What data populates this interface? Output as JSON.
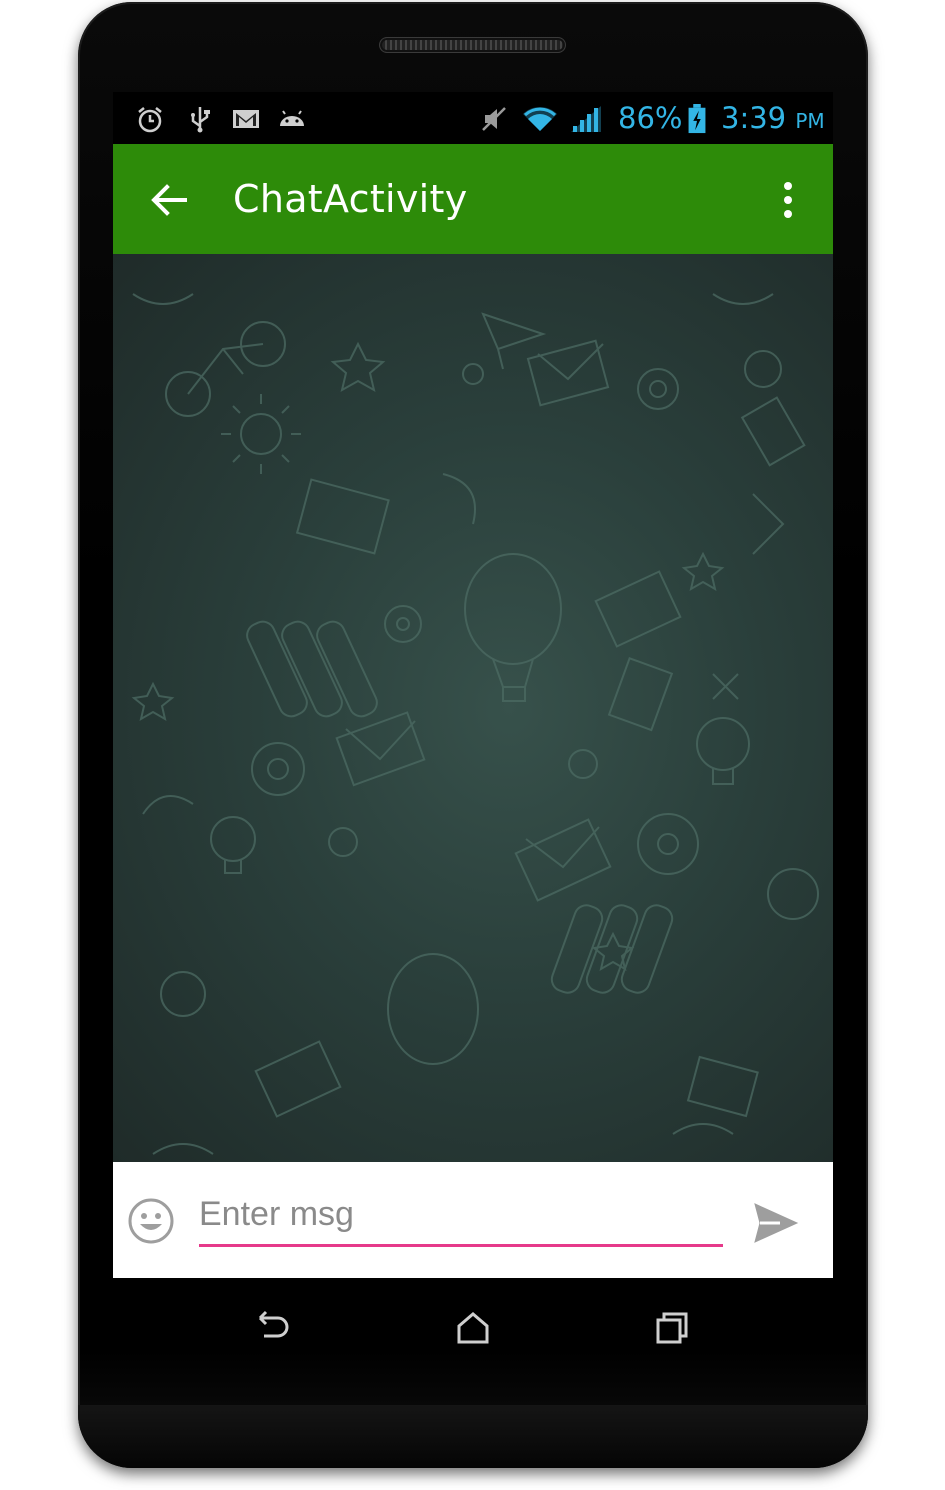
{
  "status_bar": {
    "battery_percent": "86%",
    "time": "3:39",
    "ampm": "PM",
    "icons": [
      "alarm-icon",
      "usb-icon",
      "gmail-icon",
      "android-icon",
      "mute-icon",
      "wifi-icon",
      "signal-icon",
      "battery-charging-icon"
    ],
    "accent_color": "#33b5e5"
  },
  "app_bar": {
    "title": "ChatActivity",
    "back_icon": "arrow-back-icon",
    "menu_icon": "overflow-menu-icon",
    "color": "#2d8b09"
  },
  "chat": {
    "messages": []
  },
  "composer": {
    "placeholder": "Enter msg",
    "value": "",
    "emoji_icon": "emoji-icon",
    "send_icon": "send-icon",
    "underline_color": "#e6398a"
  },
  "nav_bar": {
    "buttons": [
      "back-nav-icon",
      "home-icon",
      "recents-icon"
    ]
  }
}
